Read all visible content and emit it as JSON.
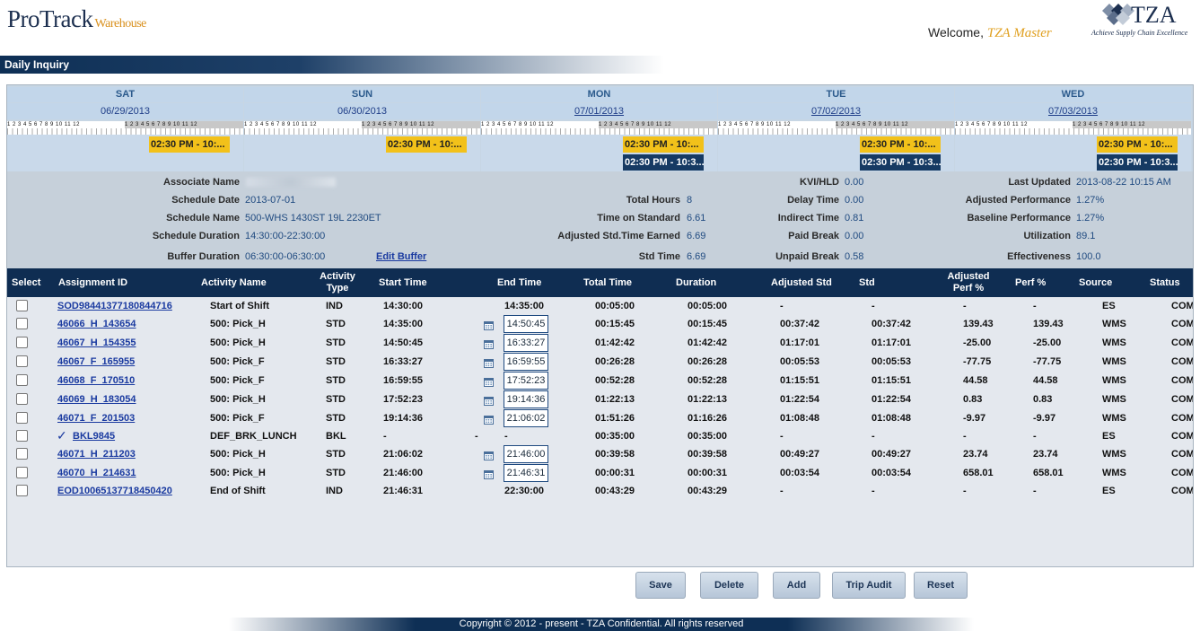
{
  "header": {
    "logo_main": "ProTrack",
    "logo_sub": "Warehouse",
    "welcome_prefix": "Welcome,",
    "welcome_user": "TZA Master",
    "brand_name": "TZA",
    "brand_tagline": "Achieve Supply Chain Excellence",
    "page_title": "Daily Inquiry"
  },
  "colors": {
    "navy": "#0f2d52",
    "shift_yellow": "#f2c11a",
    "link_blue": "#1a3aa0"
  },
  "ruler": {
    "am": "1 2 3 4 5 6 7 8 9 10 11 12",
    "pm": "1 2 3 4 5 6 7 8 9 10 11 12"
  },
  "days": [
    {
      "name": "SAT",
      "date": "06/29/2013",
      "shift1": "02:30 PM - 10:...",
      "shift2": ""
    },
    {
      "name": "SUN",
      "date": "06/30/2013",
      "shift1": "02:30 PM - 10:...",
      "shift2": ""
    },
    {
      "name": "MON",
      "date": "07/01/2013",
      "shift1": "02:30 PM - 10:...",
      "shift2": "02:30 PM - 10:3..."
    },
    {
      "name": "TUE",
      "date": "07/02/2013",
      "shift1": "02:30 PM - 10:...",
      "shift2": "02:30 PM - 10:3..."
    },
    {
      "name": "WED",
      "date": "07/03/2013",
      "shift1": "02:30 PM - 10:...",
      "shift2": "02:30 PM - 10:3..."
    }
  ],
  "info": {
    "associate_name_label": "Associate Name",
    "schedule_date_label": "Schedule Date",
    "schedule_date": "2013-07-01",
    "schedule_name_label": "Schedule Name",
    "schedule_name": "500-WHS 1430ST 19L 2230ET",
    "schedule_duration_label": "Schedule Duration",
    "schedule_duration": "14:30:00-22:30:00",
    "buffer_duration_label": "Buffer Duration",
    "buffer_duration": "06:30:00-06:30:00",
    "edit_buffer": "Edit Buffer",
    "total_hours_label": "Total Hours",
    "total_hours": "8",
    "time_on_standard_label": "Time on Standard",
    "time_on_standard": "6.61",
    "adjusted_std_label": "Adjusted Std.Time Earned",
    "adjusted_std": "6.69",
    "std_time_label": "Std Time",
    "std_time": "6.69",
    "kvi_label": "KVI/HLD",
    "kvi": "0.00",
    "delay_label": "Delay Time",
    "delay": "0.00",
    "indirect_label": "Indirect Time",
    "indirect": "0.81",
    "paid_break_label": "Paid Break",
    "paid_break": "0.00",
    "unpaid_break_label": "Unpaid Break",
    "unpaid_break": "0.58",
    "last_updated_label": "Last Updated",
    "last_updated": "2013-08-22 10:15 AM",
    "adj_perf_label": "Adjusted Performance",
    "adj_perf": "1.27%",
    "base_perf_label": "Baseline Performance",
    "base_perf": "1.27%",
    "utilization_label": "Utilization",
    "utilization": "89.1",
    "effectiveness_label": "Effectiveness",
    "effectiveness": "100.0"
  },
  "table": {
    "headers": {
      "select": "Select",
      "assignment": "Assignment ID",
      "activity": "Activity Name",
      "activity_type": "Activity Type",
      "start": "Start Time",
      "end": "End Time",
      "total": "Total Time",
      "duration": "Duration",
      "adj_std": "Adjusted Std",
      "std": "Std",
      "adj_perf": "Adjusted Perf %",
      "perf": "Perf %",
      "source": "Source",
      "status": "Status"
    },
    "rows": [
      {
        "id": "SOD98441377180844716",
        "activity": "Start of Shift",
        "type": "IND",
        "start": "14:30:00",
        "end": "14:35:00",
        "total": "00:05:00",
        "duration": "00:05:00",
        "adj_std": "-",
        "std": "-",
        "adj_perf": "-",
        "perf": "-",
        "source": "ES",
        "status": "COM",
        "editable": false,
        "checked": false
      },
      {
        "id": "46066_H_143654",
        "activity": "500: Pick_H",
        "type": "STD",
        "start": "14:35:00",
        "end": "14:50:45",
        "total": "00:15:45",
        "duration": "00:15:45",
        "adj_std": "00:37:42",
        "std": "00:37:42",
        "adj_perf": "139.43",
        "perf": "139.43",
        "source": "WMS",
        "status": "COM",
        "editable": true,
        "checked": false
      },
      {
        "id": "46067_H_154355",
        "activity": "500: Pick_H",
        "type": "STD",
        "start": "14:50:45",
        "end": "16:33:27",
        "total": "01:42:42",
        "duration": "01:42:42",
        "adj_std": "01:17:01",
        "std": "01:17:01",
        "adj_perf": "-25.00",
        "perf": "-25.00",
        "source": "WMS",
        "status": "COM",
        "editable": true,
        "checked": false
      },
      {
        "id": "46067_F_165955",
        "activity": "500: Pick_F",
        "type": "STD",
        "start": "16:33:27",
        "end": "16:59:55",
        "total": "00:26:28",
        "duration": "00:26:28",
        "adj_std": "00:05:53",
        "std": "00:05:53",
        "adj_perf": "-77.75",
        "perf": "-77.75",
        "source": "WMS",
        "status": "COM",
        "editable": true,
        "checked": false
      },
      {
        "id": "46068_F_170510",
        "activity": "500: Pick_F",
        "type": "STD",
        "start": "16:59:55",
        "end": "17:52:23",
        "total": "00:52:28",
        "duration": "00:52:28",
        "adj_std": "01:15:51",
        "std": "01:15:51",
        "adj_perf": "44.58",
        "perf": "44.58",
        "source": "WMS",
        "status": "COM",
        "editable": true,
        "checked": false
      },
      {
        "id": "46069_H_183054",
        "activity": "500: Pick_H",
        "type": "STD",
        "start": "17:52:23",
        "end": "19:14:36",
        "total": "01:22:13",
        "duration": "01:22:13",
        "adj_std": "01:22:54",
        "std": "01:22:54",
        "adj_perf": "0.83",
        "perf": "0.83",
        "source": "WMS",
        "status": "COM",
        "editable": true,
        "checked": false
      },
      {
        "id": "46071_F_201503",
        "activity": "500: Pick_F",
        "type": "STD",
        "start": "19:14:36",
        "end": "21:06:02",
        "total": "01:51:26",
        "duration": "01:16:26",
        "adj_std": "01:08:48",
        "std": "01:08:48",
        "adj_perf": "-9.97",
        "perf": "-9.97",
        "source": "WMS",
        "status": "COM",
        "editable": true,
        "checked": false
      },
      {
        "id": "BKL9845",
        "activity": "DEF_BRK_LUNCH",
        "type": "BKL",
        "start": "-",
        "end": "-",
        "total": "00:35:00",
        "duration": "00:35:00",
        "adj_std": "-",
        "std": "-",
        "adj_perf": "-",
        "perf": "-",
        "source": "ES",
        "status": "COM",
        "editable": false,
        "checked": true,
        "dash2": "-"
      },
      {
        "id": "46071_H_211203",
        "activity": "500: Pick_H",
        "type": "STD",
        "start": "21:06:02",
        "end": "21:46:00",
        "total": "00:39:58",
        "duration": "00:39:58",
        "adj_std": "00:49:27",
        "std": "00:49:27",
        "adj_perf": "23.74",
        "perf": "23.74",
        "source": "WMS",
        "status": "COM",
        "editable": true,
        "checked": false
      },
      {
        "id": "46070_H_214631",
        "activity": "500: Pick_H",
        "type": "STD",
        "start": "21:46:00",
        "end": "21:46:31",
        "total": "00:00:31",
        "duration": "00:00:31",
        "adj_std": "00:03:54",
        "std": "00:03:54",
        "adj_perf": "658.01",
        "perf": "658.01",
        "source": "WMS",
        "status": "COM",
        "editable": true,
        "checked": false
      },
      {
        "id": "EOD10065137718450420",
        "activity": "End of Shift",
        "type": "IND",
        "start": "21:46:31",
        "end": "22:30:00",
        "total": "00:43:29",
        "duration": "00:43:29",
        "adj_std": "-",
        "std": "-",
        "adj_perf": "-",
        "perf": "-",
        "source": "ES",
        "status": "COM",
        "editable": false,
        "checked": false
      }
    ]
  },
  "buttons": {
    "save": "Save",
    "delete": "Delete",
    "add": "Add",
    "trip_audit": "Trip Audit",
    "reset": "Reset"
  },
  "footer": "Copyright © 2012 - present - TZA Confidential. All rights reserved"
}
